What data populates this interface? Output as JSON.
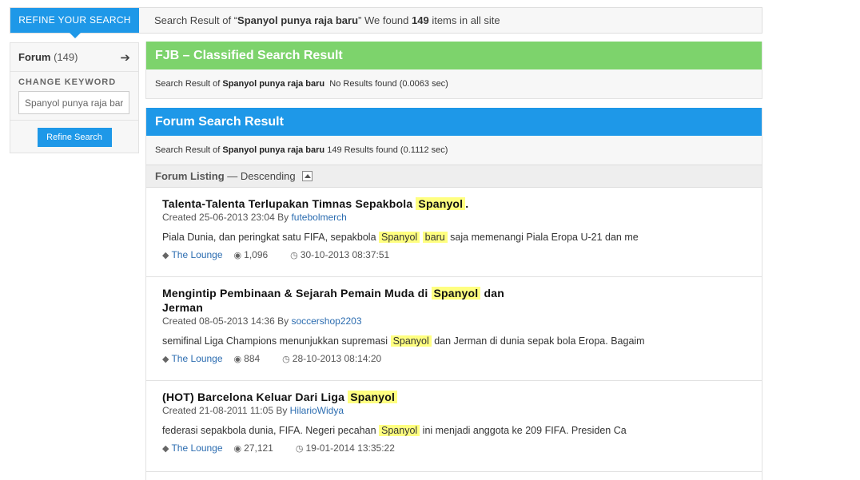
{
  "top": {
    "refine_tab": "REFINE YOUR SEARCH",
    "summary_prefix": "Search Result of “",
    "query": "Spanyol punya raja baru",
    "summary_mid": "” We found ",
    "count": "149",
    "summary_suffix": " items in all site"
  },
  "sidebar": {
    "forum_label": "Forum",
    "forum_count": "(149)",
    "keyword_label": "CHANGE KEYWORD",
    "keyword_value": "Spanyol punya raja baru",
    "refine_button": "Refine Search"
  },
  "fjb": {
    "title": "FJB – Classified Search Result",
    "sub_prefix": "Search Result of ",
    "sub_query": "Spanyol punya raja baru",
    "sub_result": "No Results found (0.0063 sec)"
  },
  "forum": {
    "title": "Forum Search Result",
    "sub_prefix": "Search Result of ",
    "sub_query": "Spanyol punya raja baru",
    "sub_result": "149 Results found (0.1112 sec)",
    "listing_label": "Forum Listing",
    "listing_order": " — Descending"
  },
  "items": [
    {
      "title_a": "Talenta-Talenta Terlupakan Timnas Sepakbola ",
      "title_hl": "Spanyol",
      "title_b": ".",
      "created": "Created 25-06-2013 23:04 By ",
      "author": "futebolmerch",
      "snip_a": "Piala Dunia, dan peringkat satu FIFA, sepakbola ",
      "snip_hl1": "Spanyol",
      "snip_hl2": "baru",
      "snip_b": " saja memenangi Piala Eropa U-21 dan me",
      "category": "The Lounge",
      "views": "1,096",
      "last": "30-10-2013 08:37:51"
    },
    {
      "title_a": "Mengintip Pembinaan & Sejarah Pemain Muda di ",
      "title_hl": "Spanyol",
      "title_b": " dan Jerman",
      "created": "Created 08-05-2013 14:36 By ",
      "author": "soccershop2203",
      "snip_a": "semifinal Liga Champions menunjukkan supremasi ",
      "snip_hl1": "Spanyol",
      "snip_b": " dan Jerman di dunia sepak bola Eropa. Bagaim",
      "category": "The Lounge",
      "views": "884",
      "last": "28-10-2013 08:14:20"
    },
    {
      "title_a": "(HOT) Barcelona Keluar Dari Liga ",
      "title_hl": "Spanyol",
      "title_b": "",
      "created": "Created 21-08-2011 11:05 By ",
      "author": "HilarioWidya",
      "snip_a": "federasi sepakbola dunia, FIFA. Negeri pecahan ",
      "snip_hl1": "Spanyol",
      "snip_b": " ini menjadi anggota ke 209 FIFA. Presiden Ca",
      "category": "The Lounge",
      "views": "27,121",
      "last": "19-01-2014 13:35:22"
    }
  ],
  "icons": {
    "tag": "tag-icon",
    "views": "eye-icon",
    "time": "clock-icon",
    "arrow": "arrow-right-icon",
    "sort": "sort-up-icon"
  }
}
